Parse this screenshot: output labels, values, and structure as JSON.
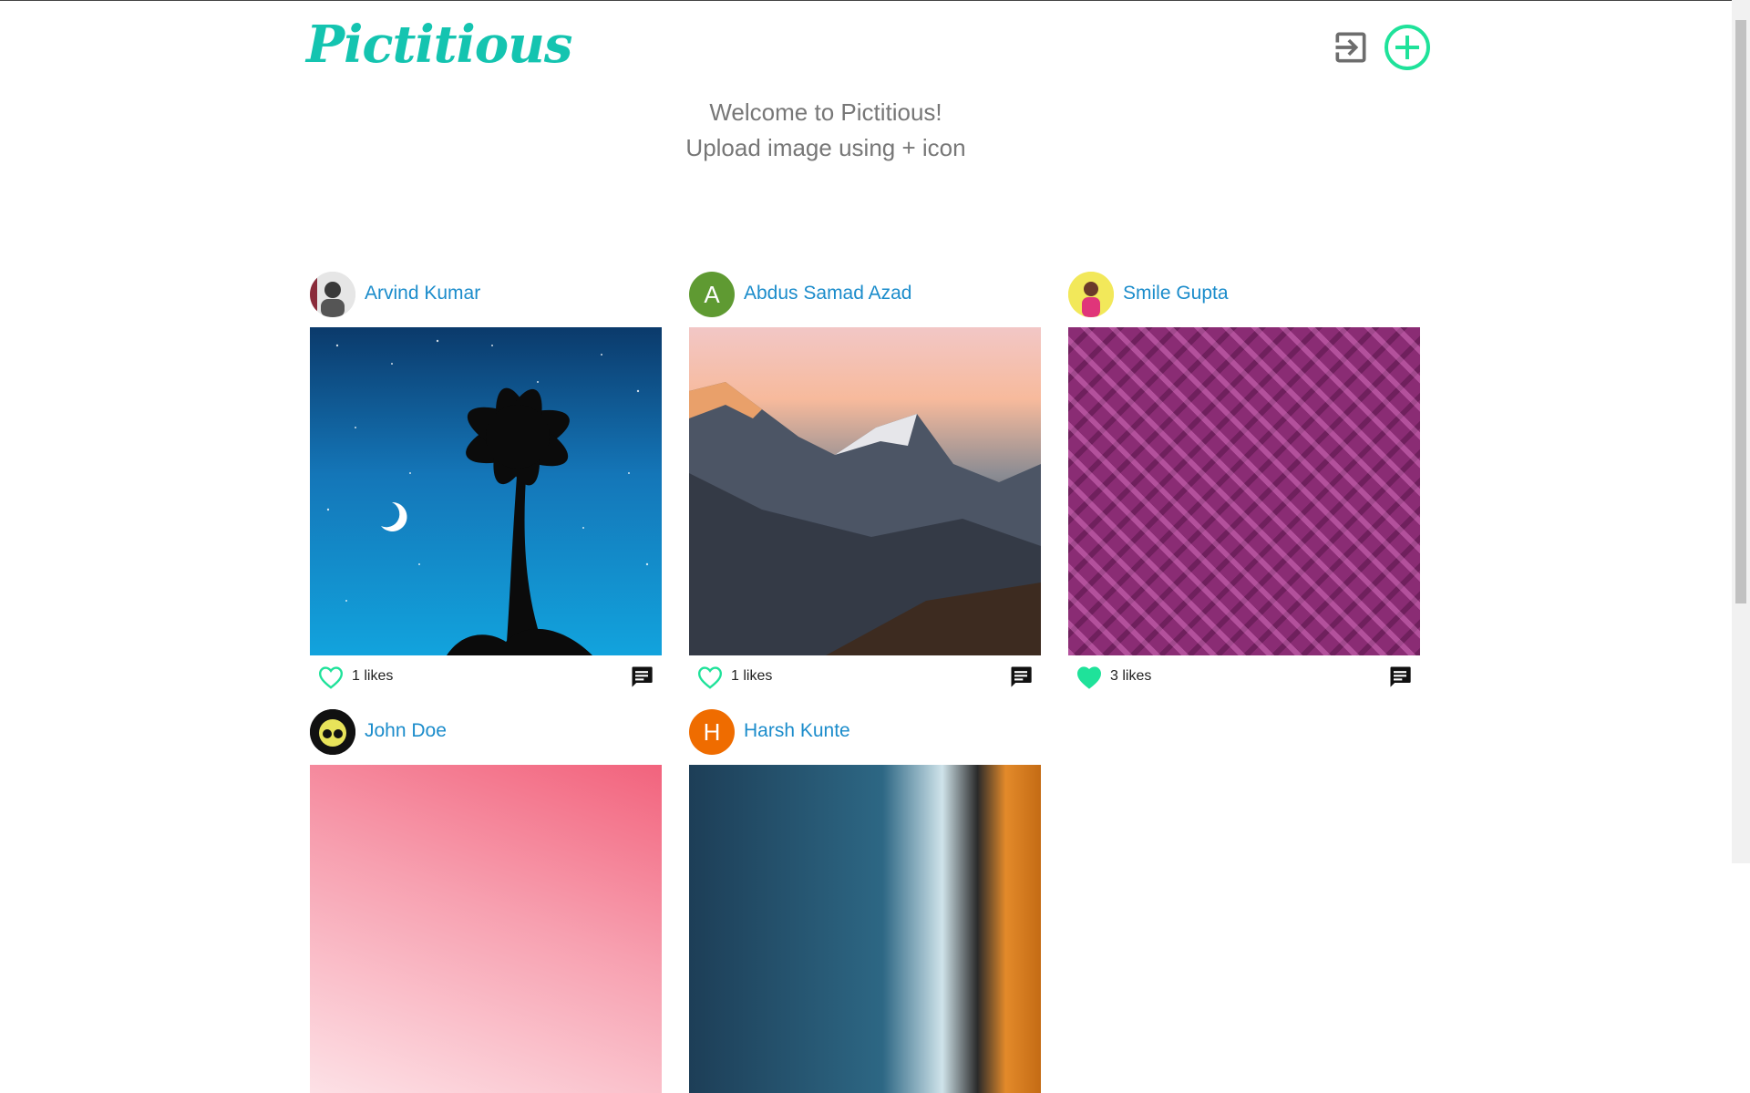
{
  "app": {
    "logo_text": "Pictitious",
    "welcome_line1": "Welcome to Pictitious!",
    "welcome_line2": "Upload image using + icon",
    "accent_color": "#1fe29a",
    "username_color": "#1b8ccb"
  },
  "header_icons": [
    "login-icon",
    "add-circle-icon"
  ],
  "posts": [
    {
      "user": "Arvind Kumar",
      "avatar_letter": "",
      "likes": "1 likes",
      "liked": false,
      "image": "palm-tree-night"
    },
    {
      "user": "Abdus Samad Azad",
      "avatar_letter": "A",
      "likes": "1 likes",
      "liked": false,
      "image": "mountain-sunset"
    },
    {
      "user": "Smile Gupta",
      "avatar_letter": "",
      "likes": "3 likes",
      "liked": true,
      "image": "purple-pattern"
    },
    {
      "user": "John Doe",
      "avatar_letter": "",
      "likes": "",
      "liked": false,
      "image": "pink-sky"
    },
    {
      "user": "Harsh Kunte",
      "avatar_letter": "H",
      "likes": "",
      "liked": false,
      "image": "aerial-coast"
    }
  ]
}
